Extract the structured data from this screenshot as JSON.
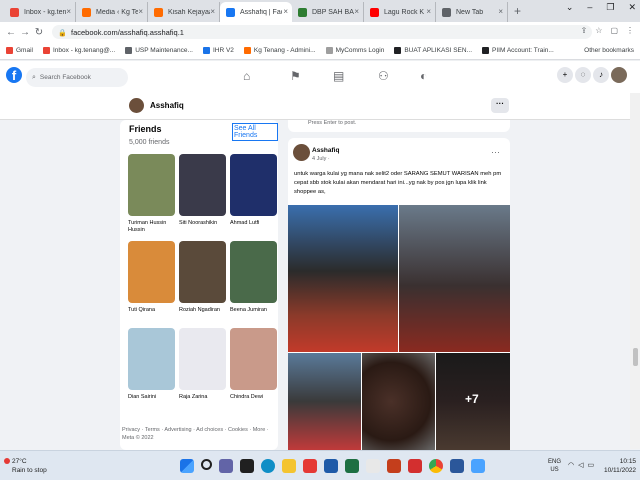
{
  "browser": {
    "tabs": [
      {
        "label": "Inbox - kg.tenang",
        "color": "#ea4335",
        "active": false
      },
      {
        "label": "Media ‹ Kg Tenang",
        "color": "#ff6b00",
        "active": false
      },
      {
        "label": "Kisah Kejayaan",
        "color": "#ff6b00",
        "active": false
      },
      {
        "label": "Asshafiq | Facebook",
        "color": "#1877f2",
        "active": true
      },
      {
        "label": "DBP SAH BAHASA",
        "color": "#2e7d32",
        "active": false
      },
      {
        "label": "Lagu Rock K",
        "color": "#ff0000",
        "active": false
      },
      {
        "label": "New Tab",
        "color": "#5f6368",
        "active": false
      }
    ],
    "url": "facebook.com/asshafiq.asshafiq.1",
    "bookmarks": [
      {
        "label": "Gmail",
        "color": "#ea4335"
      },
      {
        "label": "Inbox - kg.tenang@...",
        "color": "#ea4335"
      },
      {
        "label": "USP Maintenance...",
        "color": "#5f6368"
      },
      {
        "label": "IHR V2",
        "color": "#1a73e8"
      },
      {
        "label": "Kg Tenang - Admini...",
        "color": "#ff6b00"
      },
      {
        "label": "MyComms Login",
        "color": "#9e9e9e"
      },
      {
        "label": "BUAT APLIKASI SEN...",
        "color": "#202124"
      },
      {
        "label": "PIIM Account: Train...",
        "color": "#202124"
      }
    ],
    "other_bookmarks": "Other bookmarks"
  },
  "facebook": {
    "search_placeholder": "Search Facebook",
    "profile_name": "Asshafiq",
    "friends": {
      "title": "Friends",
      "see_all": "See All Friends",
      "count": "5,000 friends",
      "list": [
        {
          "name": "Turiman Hussin Hussin",
          "color": "#7a8a5a"
        },
        {
          "name": "Siti Noorashikin",
          "color": "#3a3a4a"
        },
        {
          "name": "Ahmad Lutfi",
          "color": "#1f2f6a"
        },
        {
          "name": "Tuti Qirana",
          "color": "#d98b3a"
        },
        {
          "name": "Roziah Ngadiran",
          "color": "#5a4a3a"
        },
        {
          "name": "Beena Jumiran",
          "color": "#4a6a4a"
        },
        {
          "name": "Dian Sairini",
          "color": "#a9c7d8"
        },
        {
          "name": "Raja Zarina",
          "color": "#e9e9ef"
        },
        {
          "name": "Chindra Dewi",
          "color": "#c99a8a"
        }
      ]
    },
    "footer": "Privacy · Terms · Advertising · Ad choices · Cookies · More · Meta © 2022",
    "prev_post_hint": "Press Enter to post.",
    "post": {
      "author": "Asshafiq",
      "date": "4 July ·",
      "text": "untuk warga kulai yg mana nak selit2 oder SARANG SEMUT WARISAN meh pm cepat sbb stok  kulai akan mendarat hari ini...yg nak by pos jgn lupa klik link shoppee as,",
      "more_count": "+7"
    }
  },
  "taskbar": {
    "weather_temp": "27°C",
    "weather_text": "Rain to stop",
    "lang": "ENG",
    "region": "US",
    "time": "10:15",
    "date": "10/11/2022"
  }
}
